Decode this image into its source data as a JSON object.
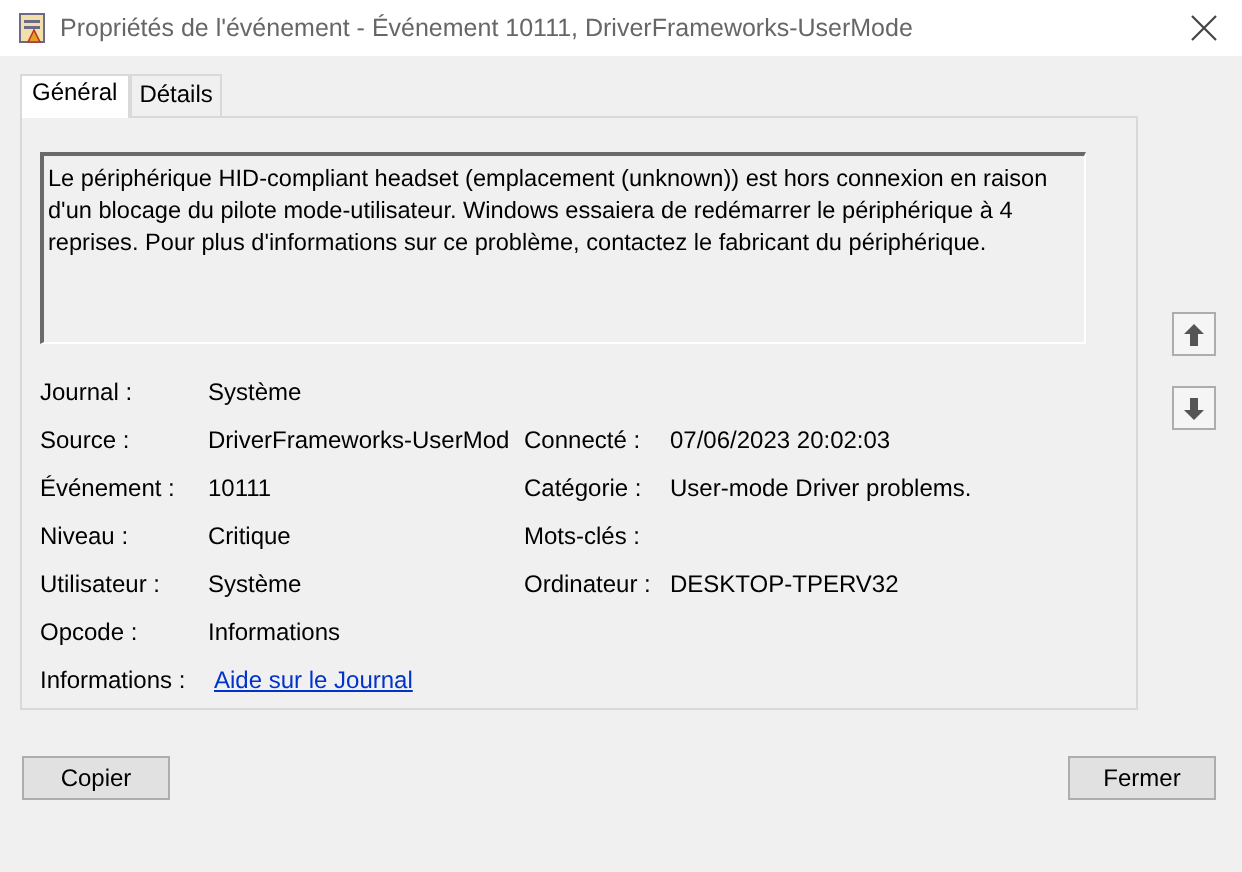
{
  "window": {
    "title": "Propriétés de l'événement - Événement 10111, DriverFrameworks-UserMode"
  },
  "tabs": [
    {
      "label": "Général",
      "selected": true
    },
    {
      "label": "Détails",
      "selected": false
    }
  ],
  "description": "Le périphérique HID-compliant headset (emplacement (unknown)) est hors connexion en raison d'un blocage du pilote mode-utilisateur. Windows essaiera de redémarrer le périphérique à 4 reprises. Pour plus d'informations sur ce problème, contactez le fabricant du périphérique.",
  "fields": [
    {
      "left": {
        "label": "Journal :",
        "value": "Système",
        "kind": "text"
      }
    },
    {
      "left": {
        "label": "Source :",
        "value": "DriverFrameworks-UserMod",
        "kind": "text"
      },
      "right": {
        "label": "Connecté :",
        "value": "07/06/2023 20:02:03"
      }
    },
    {
      "left": {
        "label": "Événement :",
        "value": "10111",
        "kind": "text"
      },
      "right": {
        "label": "Catégorie :",
        "value": "User-mode Driver problems."
      }
    },
    {
      "left": {
        "label": "Niveau :",
        "value": "Critique",
        "kind": "text"
      },
      "right": {
        "label": "Mots-clés :"
      }
    },
    {
      "left": {
        "label": "Utilisateur :",
        "value": "Système",
        "kind": "text"
      },
      "right": {
        "label": "Ordinateur :",
        "value": "DESKTOP-TPERV32"
      }
    },
    {
      "left": {
        "label": "Opcode :",
        "value": "Informations",
        "kind": "text"
      }
    },
    {
      "left": {
        "label": "Informations :",
        "value": "Aide sur le Journal",
        "kind": "link"
      }
    }
  ],
  "buttons": {
    "copy": "Copier",
    "close": "Fermer"
  }
}
